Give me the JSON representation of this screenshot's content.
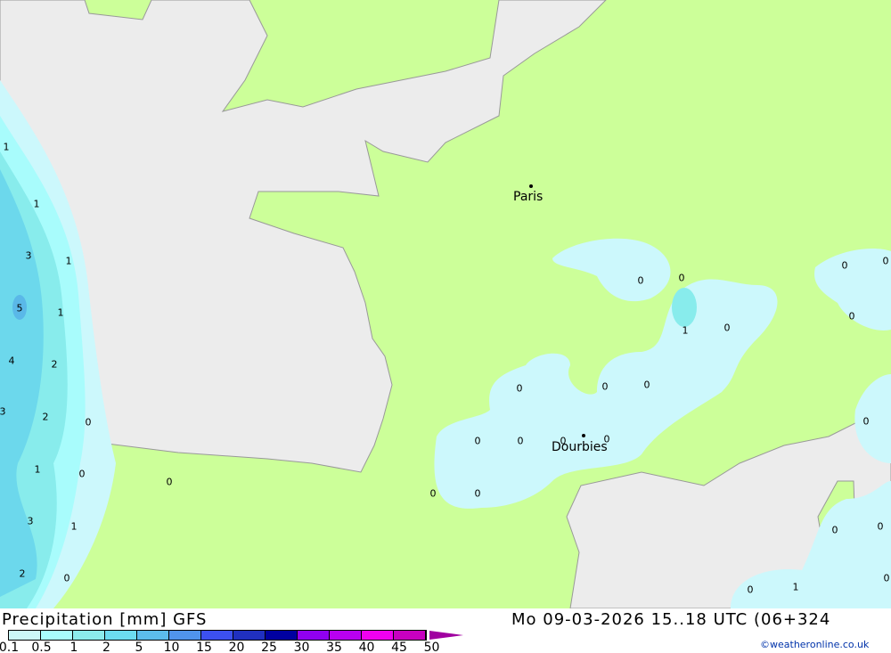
{
  "map": {
    "colors": {
      "land": "#ccff99",
      "sea": "#ececec",
      "precip_light": "#ccf8fc",
      "precip_05": "#a8fcfc",
      "precip_1": "#88ecec",
      "precip_2": "#6cd8ec",
      "precip_5": "#5ab8e8"
    },
    "cities": [
      {
        "name": "Paris"
      },
      {
        "name": "Dourbies"
      }
    ],
    "values": [
      "1",
      "1",
      "3",
      "1",
      "5",
      "1",
      "4",
      "2",
      "3",
      "2",
      "0",
      "1",
      "0",
      "0",
      "3",
      "1",
      "2",
      "0",
      "0",
      "0",
      "1",
      "0",
      "0",
      "0",
      "0",
      "0",
      "0",
      "0",
      "0",
      "0",
      "0",
      "0",
      "0",
      "0",
      "0",
      "0",
      "0",
      "0",
      "1",
      "0",
      "0"
    ]
  },
  "footer": {
    "title": "Precipitation [mm] GFS",
    "date": "Mo 09-03-2026 15..18 UTC (06+324",
    "credit": "©weatheronline.co.uk",
    "legend": {
      "ticks": [
        "0.1",
        "0.5",
        "1",
        "2",
        "5",
        "10",
        "15",
        "20",
        "25",
        "30",
        "35",
        "40",
        "45",
        "50"
      ],
      "colors": [
        "#ccf8f8",
        "#a8fcfc",
        "#8cecec",
        "#6cdcf0",
        "#5cbcec",
        "#5094ec",
        "#3c50f0",
        "#2030c0",
        "#0000a0",
        "#9000f0",
        "#b800f0",
        "#f000f0",
        "#c800c0"
      ]
    }
  }
}
